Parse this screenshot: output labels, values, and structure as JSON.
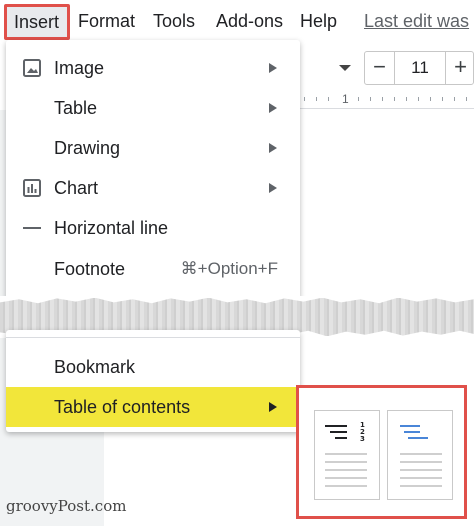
{
  "menubar": {
    "items": [
      "Insert",
      "Format",
      "Tools",
      "Add-ons",
      "Help"
    ],
    "last_edit": "Last edit was"
  },
  "toolbar": {
    "font_size": "11",
    "minus": "−",
    "plus": "+"
  },
  "ruler": {
    "mark": "1"
  },
  "insert_menu": {
    "items": [
      {
        "label": "Image",
        "icon": "image-icon",
        "submenu": true
      },
      {
        "label": "Table",
        "submenu": true
      },
      {
        "label": "Drawing",
        "submenu": true
      },
      {
        "label": "Chart",
        "icon": "chart-icon",
        "submenu": true
      },
      {
        "label": "Horizontal line",
        "icon": "horizontal-line-icon"
      },
      {
        "label": "Footnote",
        "shortcut": "⌘+Option+F"
      },
      {
        "label": "Bookmark"
      },
      {
        "label": "Table of contents",
        "submenu": true,
        "highlighted": true
      }
    ]
  },
  "toc_options": {
    "with_page_numbers": {
      "numbers": [
        "1",
        "2",
        "3"
      ]
    },
    "with_blue_links": {}
  },
  "colors": {
    "highlight": "#f2e63a",
    "callout": "#e0504a",
    "link_blue": "#4a86d8"
  },
  "watermark": "groovyPost.com"
}
